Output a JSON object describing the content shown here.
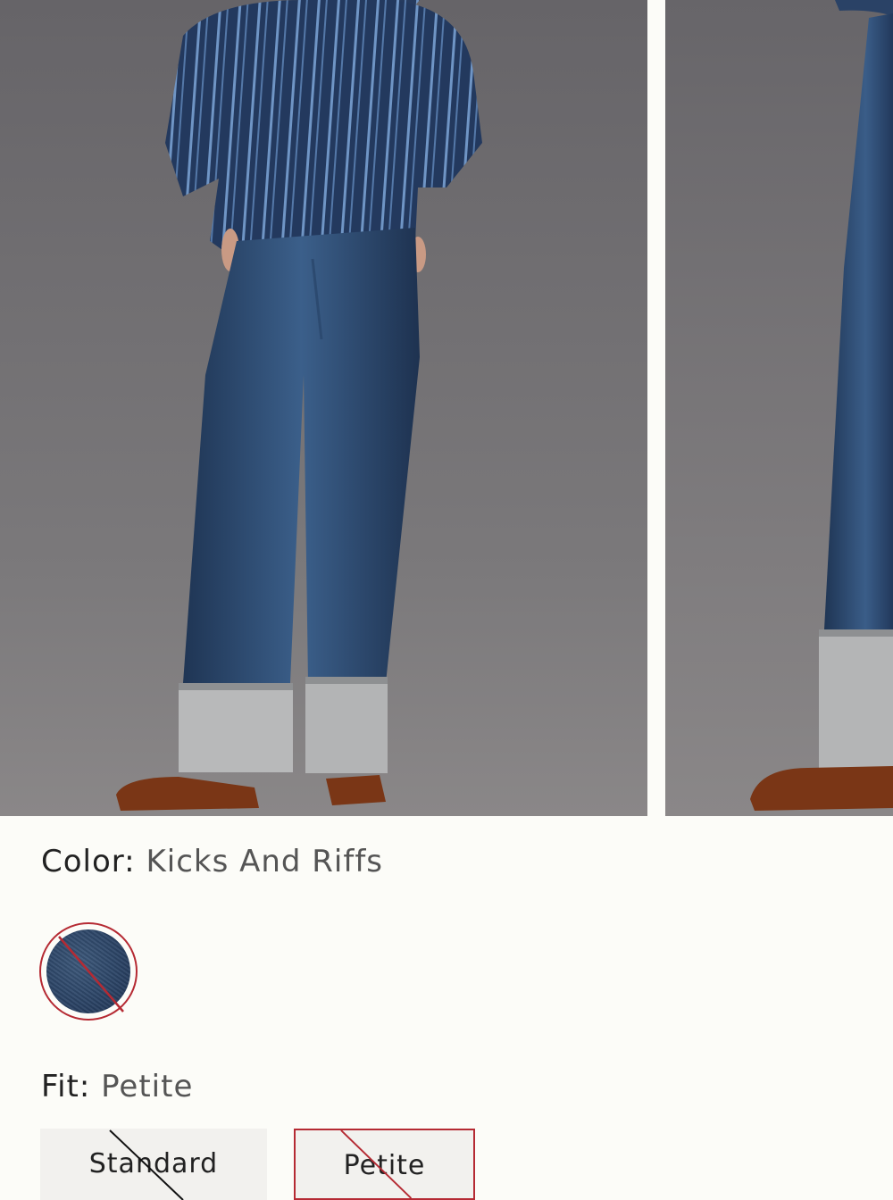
{
  "color": {
    "label": "Color:",
    "value": "Kicks And Riffs",
    "swatches": [
      {
        "name": "Kicks And Riffs",
        "available": false,
        "selected": true,
        "hex": "#2a4264"
      }
    ]
  },
  "fit": {
    "label": "Fit:",
    "value": "Petite",
    "options": [
      {
        "label": "Standard",
        "available": false,
        "selected": false
      },
      {
        "label": "Petite",
        "available": false,
        "selected": true
      }
    ]
  },
  "colors": {
    "accent": "#b52a33",
    "page_background": "#fcfcf8",
    "button_background": "#f2f1ee"
  },
  "icons": {
    "unavailable_mark": "diagonal-slash-icon"
  }
}
